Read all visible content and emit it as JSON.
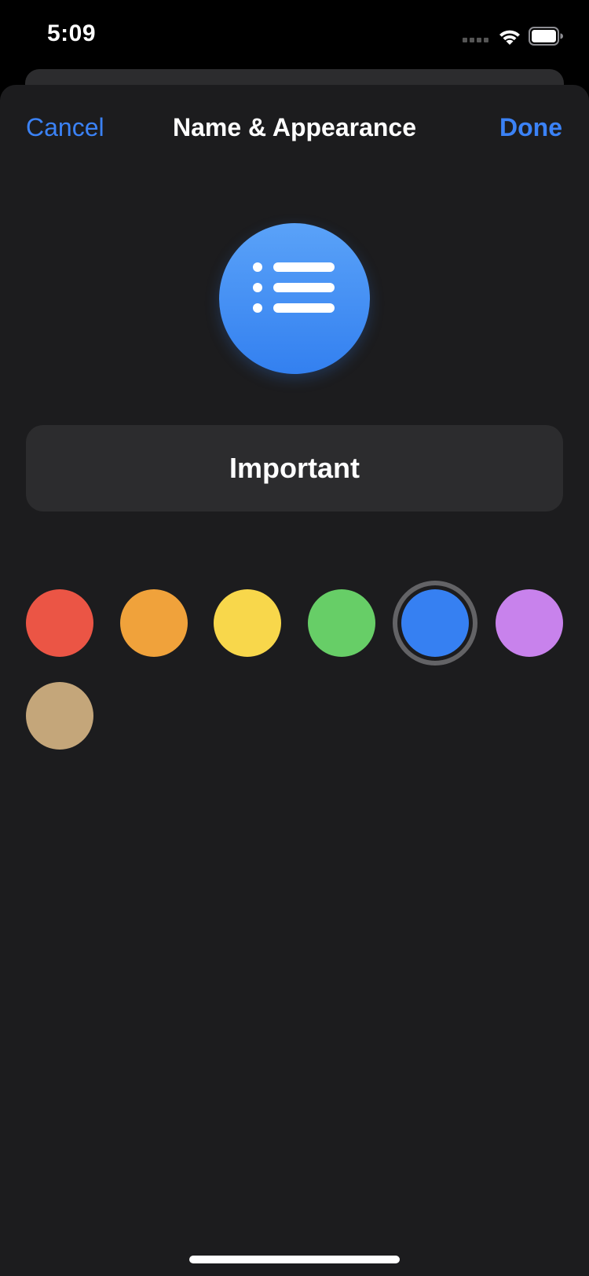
{
  "status_bar": {
    "time": "5:09",
    "icons": [
      "cellular-signal-icon",
      "wifi-icon",
      "battery-icon"
    ]
  },
  "nav": {
    "cancel_label": "Cancel",
    "title": "Name & Appearance",
    "done_label": "Done",
    "accent_color": "#3b82f6"
  },
  "list_icon": {
    "icon": "list-bullet-icon",
    "color": "#3a84f2"
  },
  "name_field": {
    "value": "Important",
    "placeholder": ""
  },
  "colors": {
    "selected": "blue",
    "options": [
      {
        "name": "red",
        "hex": "#eb5545"
      },
      {
        "name": "orange",
        "hex": "#f0a23b"
      },
      {
        "name": "yellow",
        "hex": "#f8d74b"
      },
      {
        "name": "green",
        "hex": "#67ce67"
      },
      {
        "name": "blue",
        "hex": "#3680f2"
      },
      {
        "name": "purple",
        "hex": "#c882ec"
      },
      {
        "name": "brown",
        "hex": "#c4a67a"
      }
    ]
  }
}
